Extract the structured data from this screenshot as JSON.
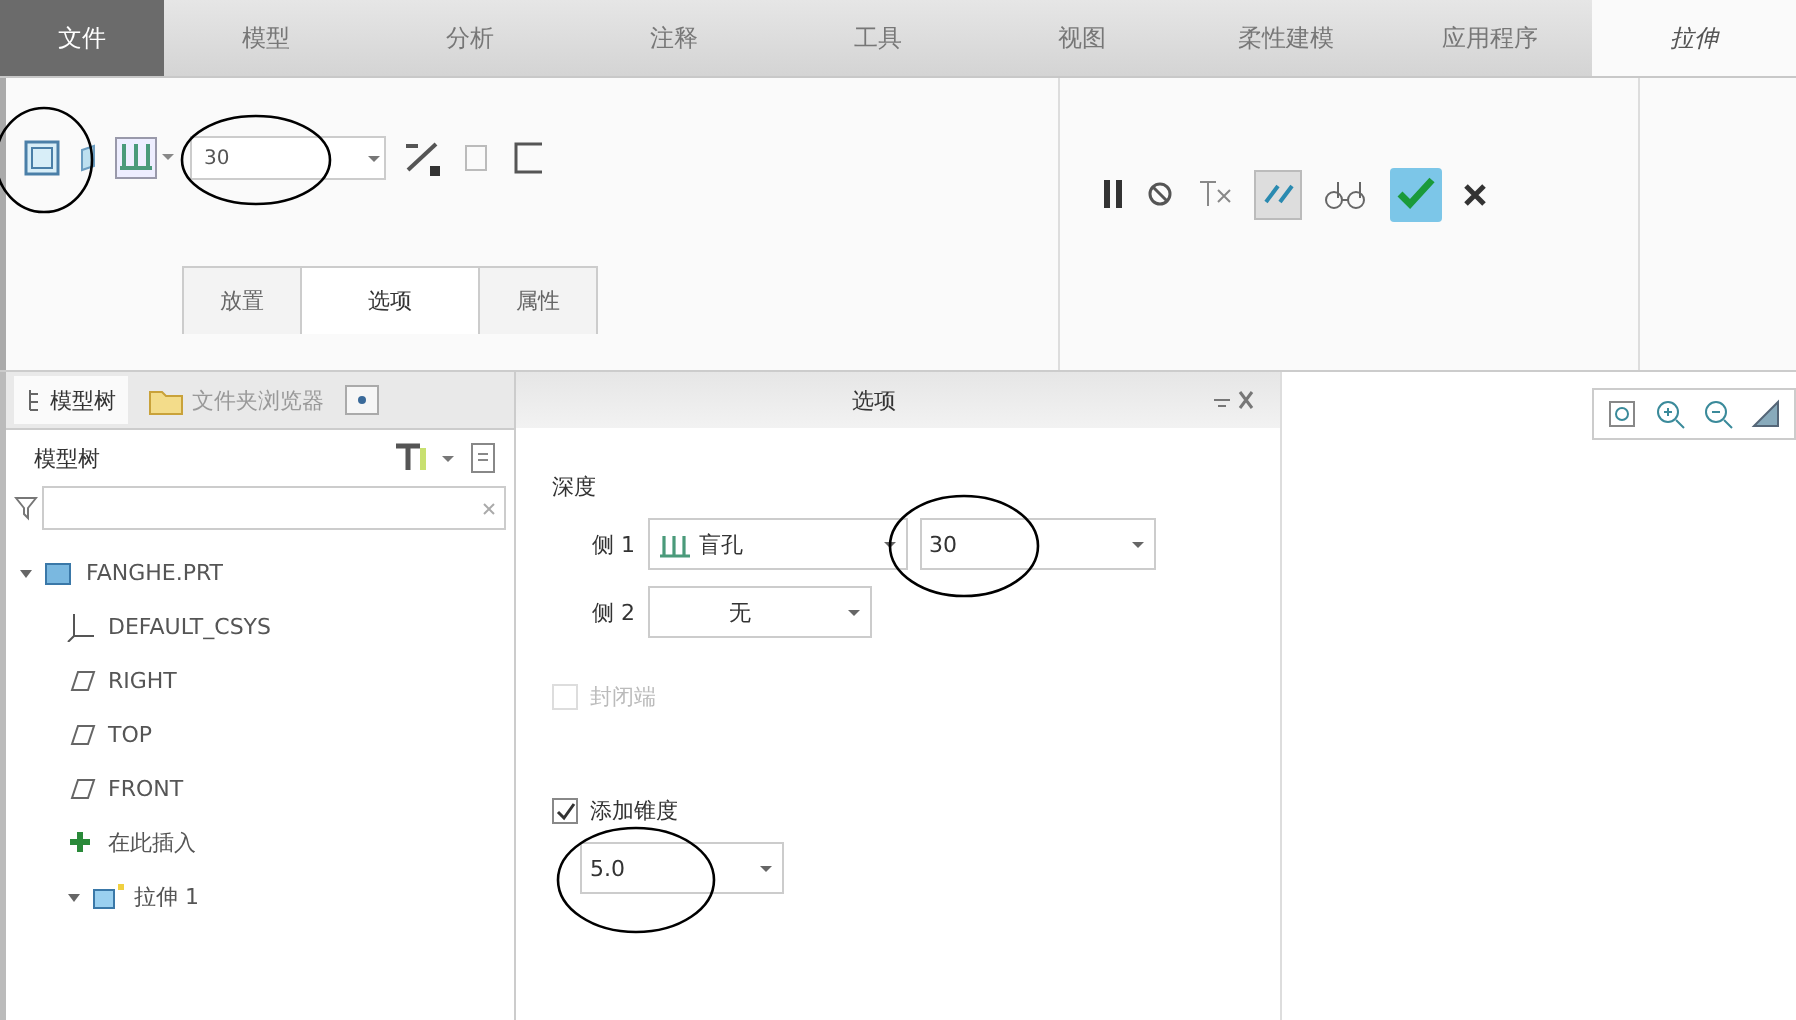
{
  "menu_tabs": [
    {
      "label": "文件",
      "kind": "file",
      "selected": false
    },
    {
      "label": "模型",
      "kind": "tab",
      "selected": false
    },
    {
      "label": "分析",
      "kind": "tab",
      "selected": false
    },
    {
      "label": "注释",
      "kind": "tab",
      "selected": false
    },
    {
      "label": "工具",
      "kind": "tab",
      "selected": false
    },
    {
      "label": "视图",
      "kind": "tab",
      "selected": false
    },
    {
      "label": "柔性建模",
      "kind": "tab",
      "selected": false
    },
    {
      "label": "应用程序",
      "kind": "tab",
      "selected": false
    },
    {
      "label": "拉伸",
      "kind": "tab",
      "selected": true
    }
  ],
  "ribbon": {
    "depth_value": "30"
  },
  "sub_tabs": [
    {
      "label": "放置",
      "selected": false
    },
    {
      "label": "选项",
      "selected": true
    },
    {
      "label": "属性",
      "selected": false
    }
  ],
  "nav_tabs": [
    {
      "label": "模型树",
      "selected": true
    },
    {
      "label": "文件夹浏览器",
      "selected": false
    }
  ],
  "tree": {
    "title": "模型树",
    "items": [
      {
        "label": "FANGHE.PRT",
        "kind": "part",
        "expanded": true,
        "children": [
          {
            "label": "DEFAULT_CSYS",
            "kind": "csys"
          },
          {
            "label": "RIGHT",
            "kind": "plane"
          },
          {
            "label": "TOP",
            "kind": "plane"
          },
          {
            "label": "FRONT",
            "kind": "plane"
          },
          {
            "label": "在此插入",
            "kind": "insert"
          },
          {
            "label": "拉伸 1",
            "kind": "feature",
            "expanded": true
          }
        ]
      }
    ]
  },
  "options_panel": {
    "title": "选项",
    "section": "深度",
    "sides": [
      {
        "label": "侧 1",
        "type": "盲孔",
        "value": "30"
      },
      {
        "label": "侧 2",
        "type": "无"
      }
    ],
    "capped_ends": {
      "label": "封闭端",
      "checked": false,
      "disabled": true
    },
    "taper": {
      "label": "添加锥度",
      "checked": true,
      "value": "5.0"
    }
  }
}
